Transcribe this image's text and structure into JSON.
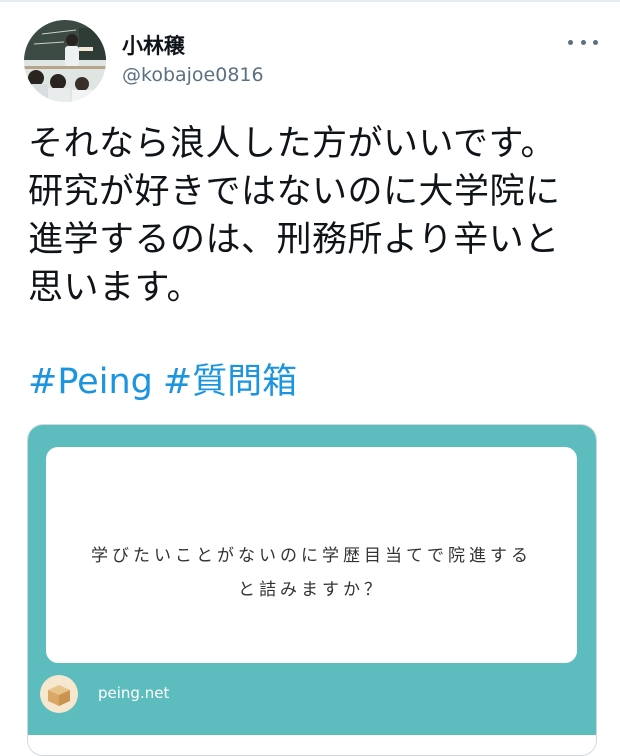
{
  "user": {
    "display_name": "小林穣",
    "handle": "@kobajoe0816"
  },
  "tweet": {
    "lines": [
      "それなら浪人した方がいいです。",
      "研究が好きではないのに大学院に",
      "進学するのは、刑務所より辛いと",
      "思います。"
    ],
    "hashtags": [
      "#Peing",
      "#質問箱"
    ]
  },
  "card": {
    "question_lines": [
      "学びたいことがないのに学歴目当てで院進する",
      "と詰みますか？"
    ],
    "site": "peing.net",
    "logo_icon": "box-icon",
    "colors": {
      "teal": "#5dbdbe",
      "hashtag": "#1b95e0",
      "muted": "#5b7083"
    }
  },
  "icons": {
    "more": "more-options-icon",
    "avatar": "profile-avatar"
  }
}
